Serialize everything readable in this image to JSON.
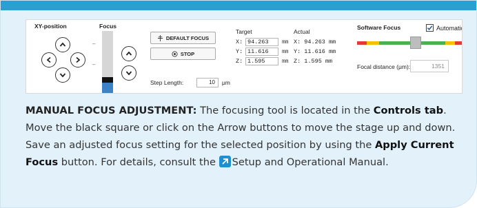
{
  "xy": {
    "title": "XY-position"
  },
  "focus": {
    "title": "Focus",
    "minus": "–"
  },
  "buttons": {
    "default_focus": "DEFAULT FOCUS",
    "stop": "STOP"
  },
  "step": {
    "label": "Step Length:",
    "value": "10",
    "unit": "μm"
  },
  "target": {
    "title": "Target",
    "x_label": "X:",
    "x": "94.263",
    "y_label": "Y:",
    "y": "11.616",
    "z_label": "Z:",
    "z": "1.595",
    "unit": "mm"
  },
  "actual": {
    "title": "Actual",
    "x": "X: 94.263 mm",
    "y": "Y: 11.616 mm",
    "z": "Z: 1.595 mm"
  },
  "software_focus": {
    "title": "Software Focus",
    "automatic_label": "Automatic",
    "automatic_checked": true,
    "focal_label": "Focal distance (μm):",
    "focal_value": "1351",
    "bar_colors": [
      "#e53935",
      "#f2c200",
      "#4caf50",
      "#f2c200",
      "#e53935"
    ]
  },
  "description": {
    "lead": "MANUAL FOCUS ADJUSTMENT:",
    "t1": " The focusing tool is located in the ",
    "controls_tab": "Controls tab",
    "t2": ". Move the black square or click on the Arrow buttons to move the stage up and down. Save an adjusted focus setting for the selected position by using the ",
    "apply_button": "Apply Current Focus",
    "t3": " button. For details, consult the ",
    "manual": "Setup and Operational Manual",
    "t4": "."
  },
  "colors": {
    "accent": "#2a9fd4",
    "card_bg": "#e3f2fa",
    "manual_icon": "#1e8fd0"
  },
  "icons": [
    "chevron-up-icon",
    "chevron-left-icon",
    "chevron-right-icon",
    "chevron-down-icon",
    "crosshair-icon",
    "target-icon",
    "checkmark-icon",
    "external-link-icon"
  ]
}
